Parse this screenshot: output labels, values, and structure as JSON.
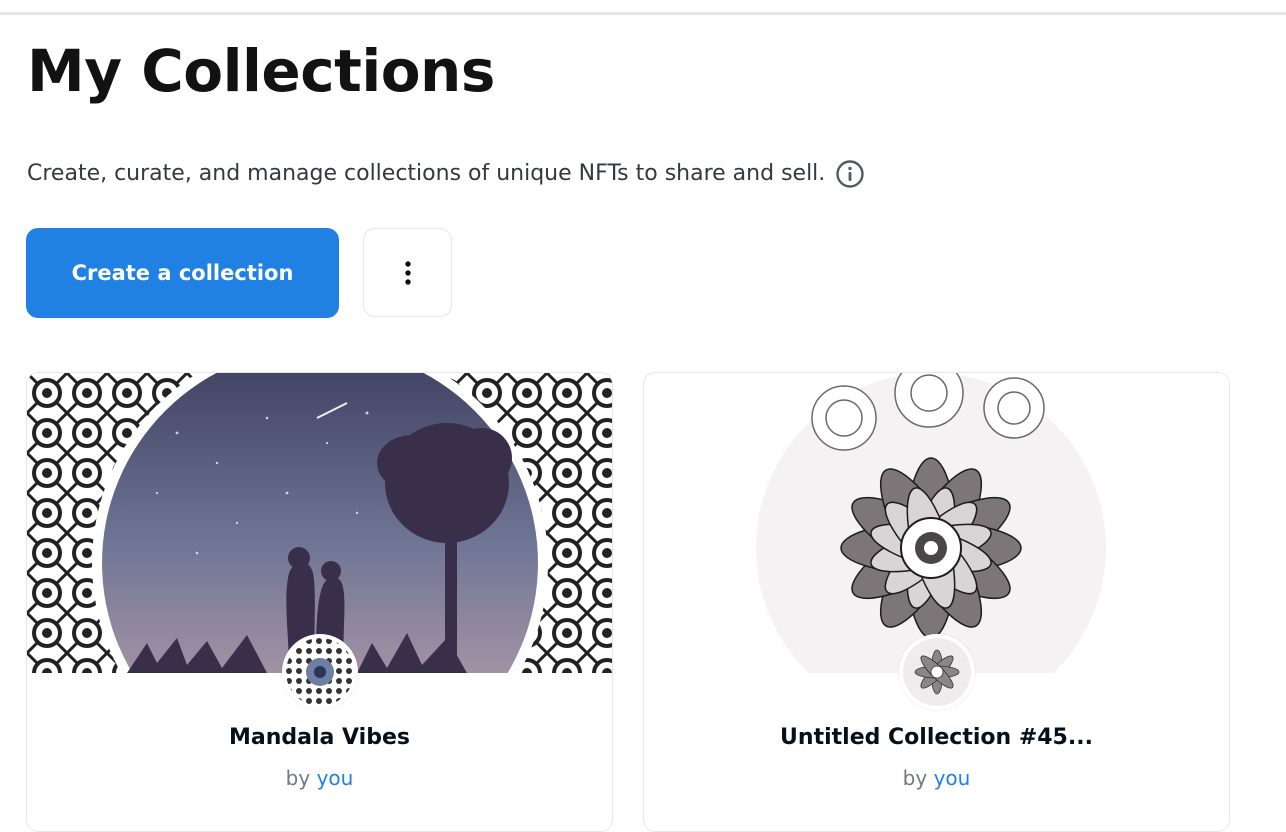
{
  "page": {
    "title": "My Collections",
    "subtitle": "Create, curate, and manage collections of unique NFTs to share and sell.",
    "info_icon": "info-circle-icon"
  },
  "actions": {
    "create_label": "Create a collection",
    "more_icon": "vertical-ellipsis-icon"
  },
  "collections": [
    {
      "name": "Mandala Vibes",
      "by_prefix": "by",
      "by_user": "you"
    },
    {
      "name": "Untitled Collection #45...",
      "by_prefix": "by",
      "by_user": "you"
    }
  ],
  "colors": {
    "accent": "#2081e2",
    "title": "#121212",
    "muted": "#707a83"
  }
}
